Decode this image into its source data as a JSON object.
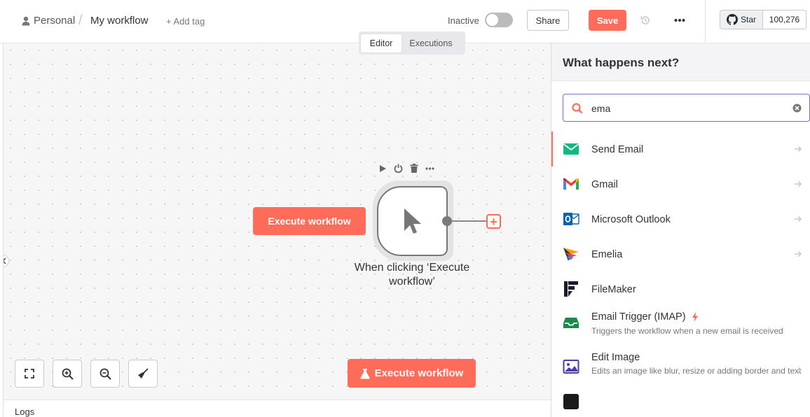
{
  "header": {
    "breadcrumb_owner": "Personal",
    "breadcrumb_separator": "/",
    "workflow_name": "My workflow",
    "add_tag": "+ Add tag",
    "status_label": "Inactive",
    "share_label": "Share",
    "save_label": "Save",
    "github_star_label": "Star",
    "github_star_count": "100,276"
  },
  "tabs": [
    {
      "label": "Editor",
      "active": true
    },
    {
      "label": "Executions",
      "active": false
    }
  ],
  "canvas": {
    "execute_inline_label": "Execute workflow",
    "trigger_node_label": "When clicking ‘Execute workflow’",
    "add_node_symbol": "+",
    "execute_bottom_label": "Execute workflow"
  },
  "logs": {
    "label": "Logs"
  },
  "panel": {
    "title": "What happens next?",
    "search_value": "ema",
    "results": [
      {
        "name": "Send Email",
        "icon": "envelope-icon",
        "selected": true
      },
      {
        "name": "Gmail",
        "icon": "gmail-icon"
      },
      {
        "name": "Microsoft Outlook",
        "icon": "outlook-icon"
      },
      {
        "name": "Emelia",
        "icon": "emelia-icon"
      },
      {
        "name": "FileMaker",
        "icon": "filemaker-icon"
      },
      {
        "name": "Email Trigger (IMAP)",
        "icon": "inbox-icon",
        "description": "Triggers the workflow when a new email is received",
        "trigger": true
      },
      {
        "name": "Edit Image",
        "icon": "image-icon",
        "description": "Edits an image like blur, resize or adding border and text"
      }
    ]
  },
  "colors": {
    "accent": "#ff6d5a",
    "search_border": "#7b6fcb"
  }
}
